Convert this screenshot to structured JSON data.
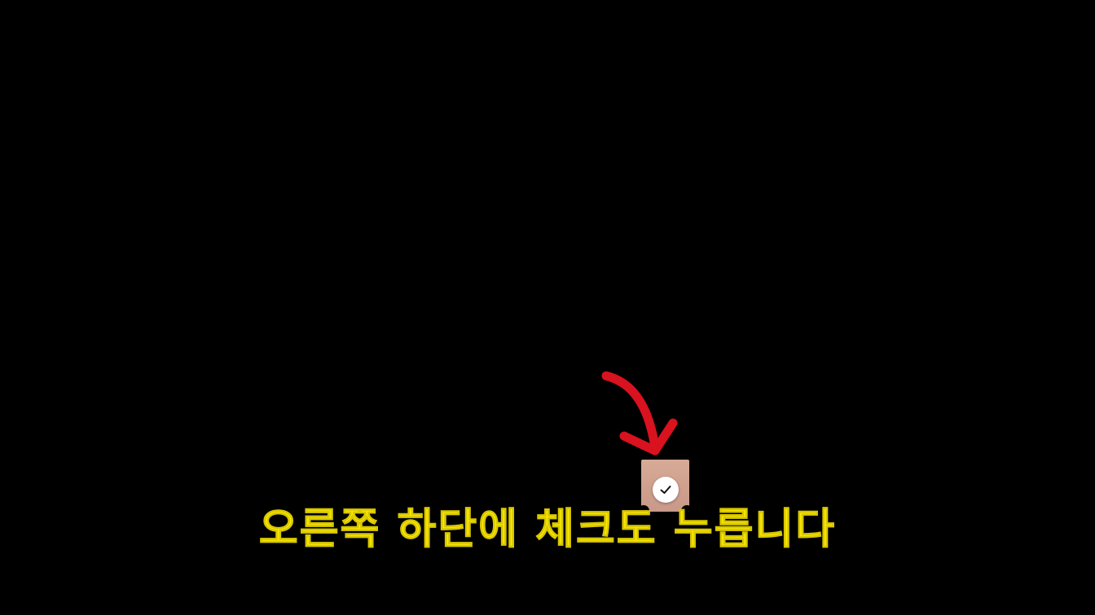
{
  "caption": {
    "text": "오른쪽 하단에 체크도 누릅니다",
    "color": "#ffec00"
  },
  "annotation": {
    "arrow_icon": "curved-arrow-icon",
    "arrow_color": "#d8121e"
  },
  "thumbnail": {
    "confirm_icon": "check-icon",
    "confirm_color": "#ffffff"
  },
  "background_color": "#000000"
}
